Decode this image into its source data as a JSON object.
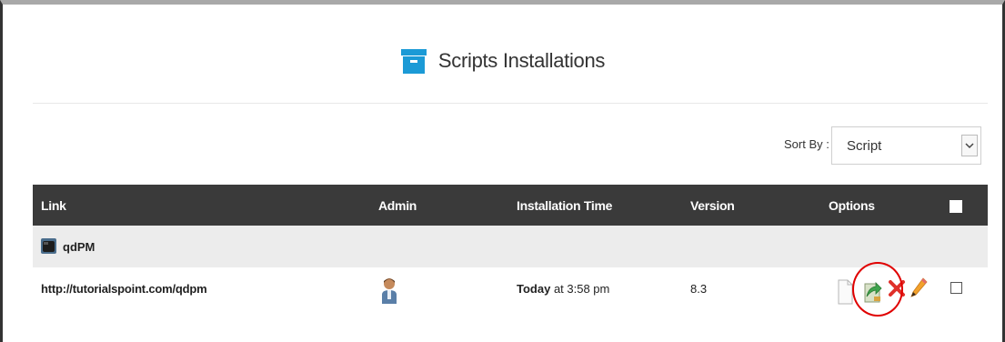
{
  "panel": {
    "title": "Scripts Installations",
    "title_icon": "archive-box-icon",
    "accent_color": "#1b9ad6"
  },
  "sort": {
    "label": "Sort By :",
    "selected": "Script"
  },
  "table": {
    "columns": [
      "Link",
      "Admin",
      "Installation Time",
      "Version",
      "Options"
    ],
    "header_bg": "#3a3a3a",
    "group": {
      "name": "qdPM",
      "icon": "qdpm-app-icon"
    },
    "rows": [
      {
        "link": "http://tutorialspoint.com/qdpm",
        "admin_icon": "admin-user-icon",
        "time_bold": "Today",
        "time_rest": " at 3:58 pm",
        "version": "8.3",
        "options": [
          "file-icon",
          "upgrade-icon",
          "delete-icon",
          "edit-icon",
          "select-checkbox"
        ]
      }
    ]
  },
  "annotation": {
    "highlight_color": "#e00000",
    "highlighted_option": "upgrade-icon"
  }
}
